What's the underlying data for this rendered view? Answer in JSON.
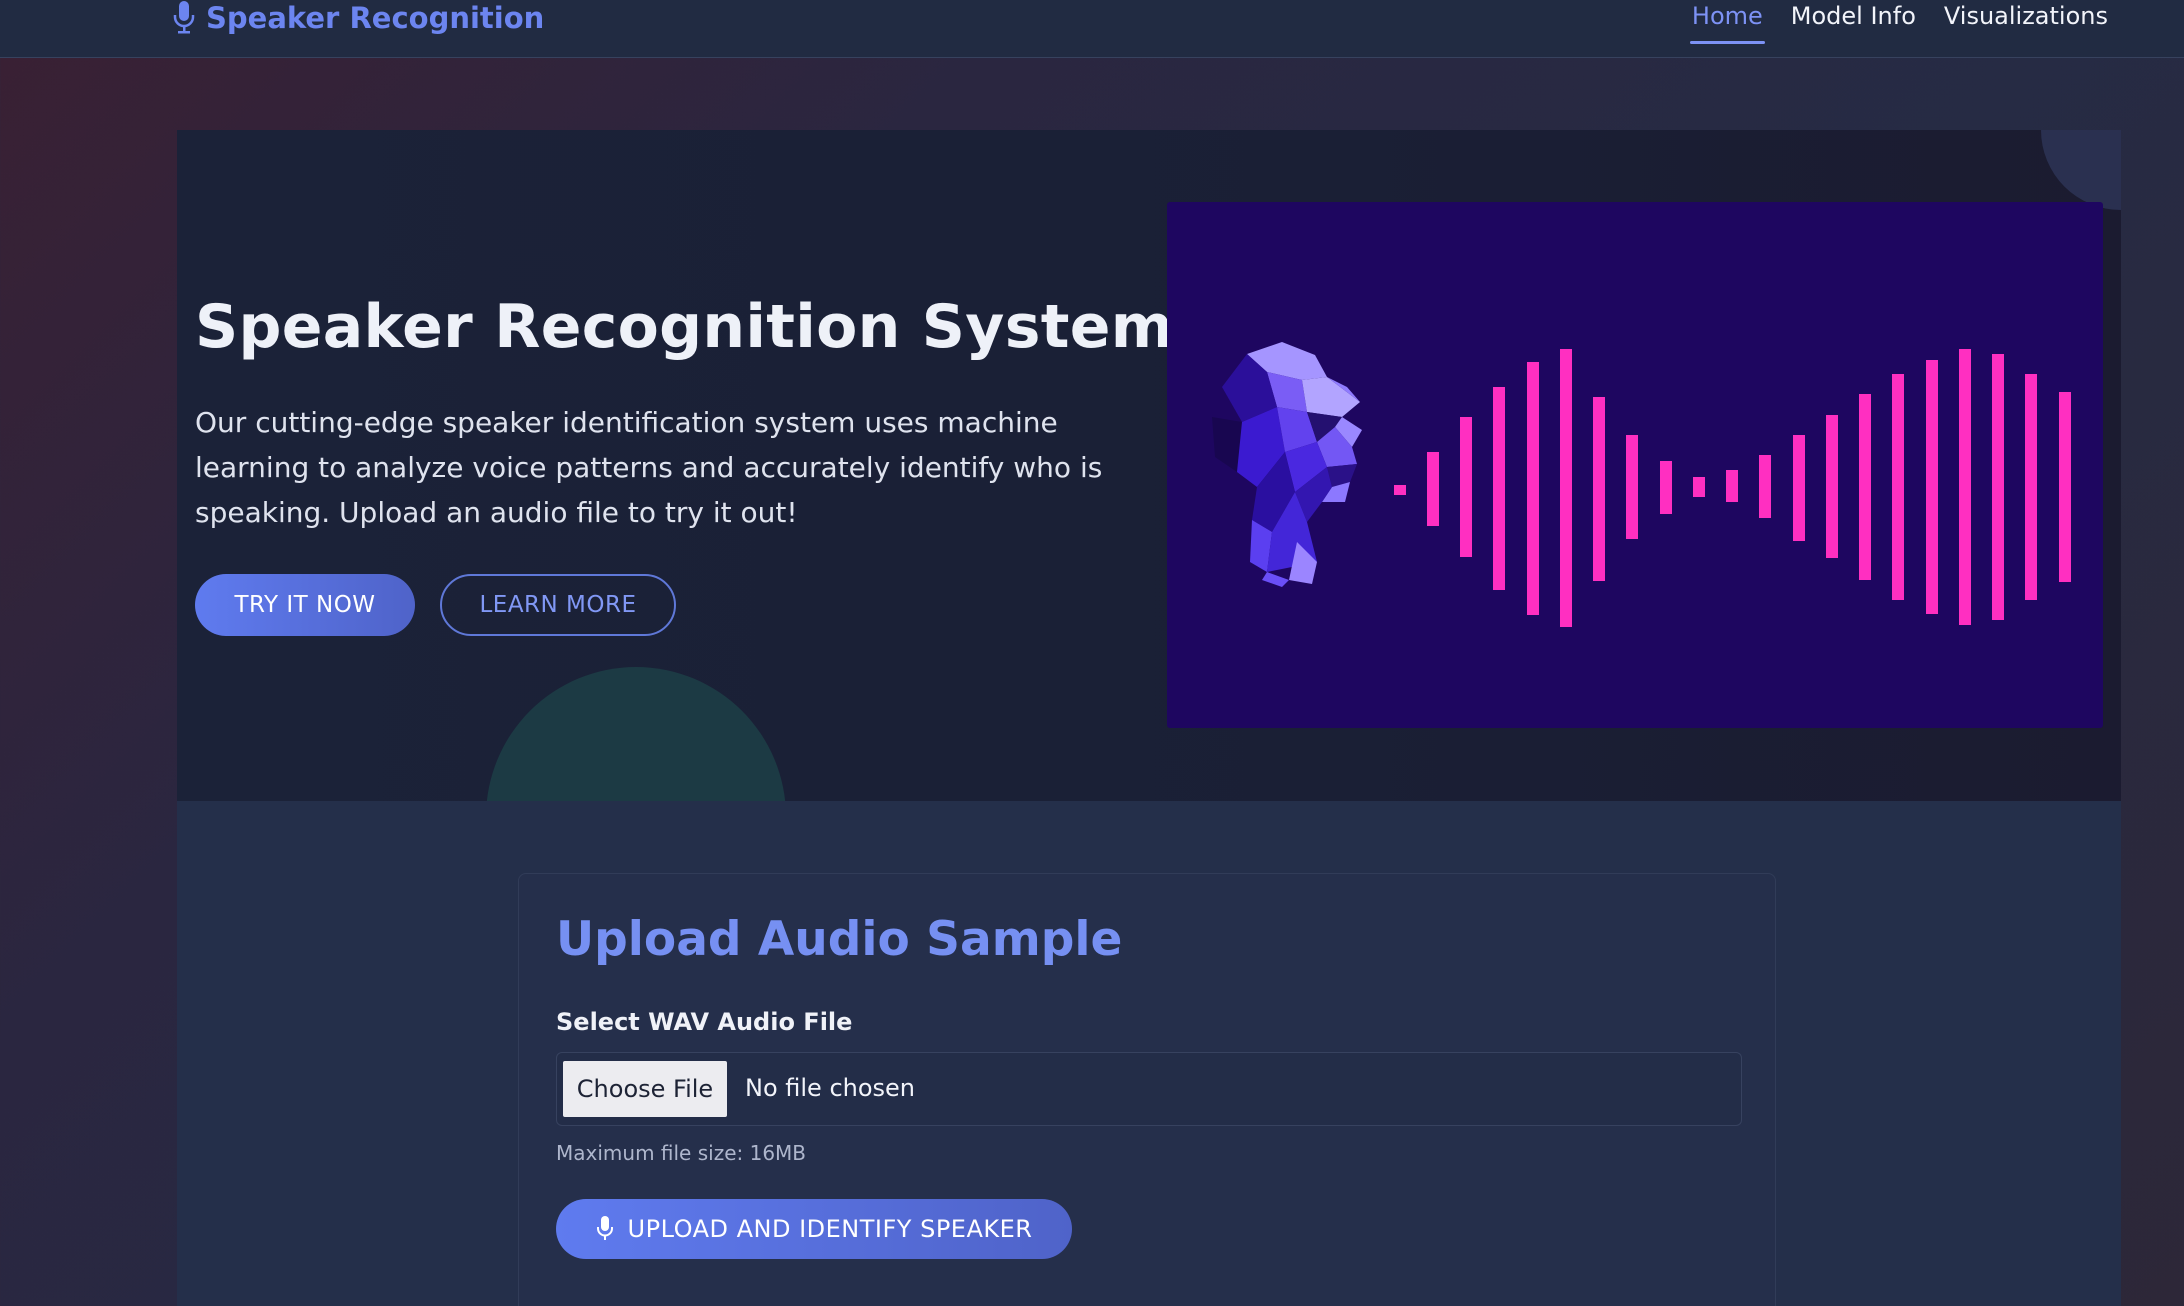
{
  "navbar": {
    "brand": "Speaker Recognition",
    "brand_icon": "microphone-icon",
    "links": [
      {
        "label": "Home",
        "active": true
      },
      {
        "label": "Model Info",
        "active": false
      },
      {
        "label": "Visualizations",
        "active": false
      }
    ]
  },
  "hero": {
    "title": "Speaker Recognition System",
    "description": "Our cutting-edge speaker identification system uses machine learning to analyze voice patterns and accurately identify who is speaking. Upload an audio file to try it out!",
    "primary_button": "TRY IT NOW",
    "secondary_button": "LEARN MORE",
    "image": "low-poly-head-with-sound-waves"
  },
  "upload": {
    "title": "Upload Audio Sample",
    "field_label": "Select WAV Audio File",
    "choose_button": "Choose File",
    "file_status": "No file chosen",
    "hint": "Maximum file size: 16MB",
    "submit_button": "UPLOAD AND IDENTIFY SPEAKER",
    "submit_icon": "microphone-icon"
  },
  "colors": {
    "accent": "#6c85f0",
    "wave": "#ff2fc1",
    "hero_image_bg": "#1e0660"
  }
}
